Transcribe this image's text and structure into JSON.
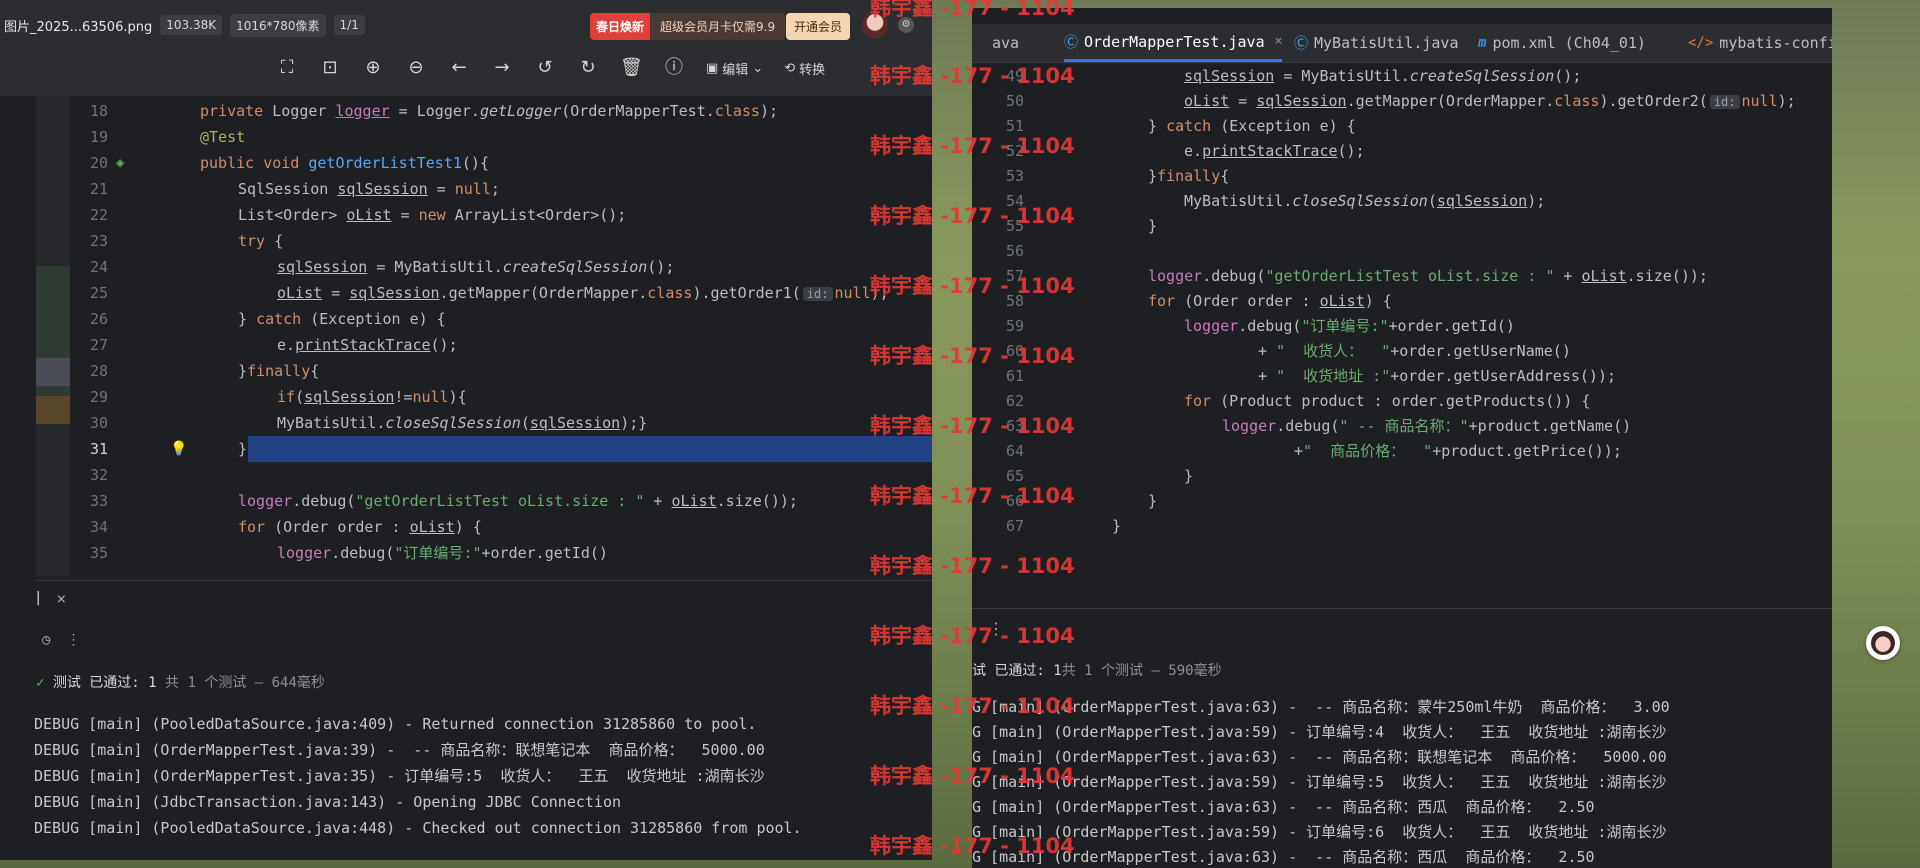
{
  "viewer": {
    "filename": "图片_2025...63506.png",
    "filesize": "103.38K",
    "dimensions": "1016*780像素",
    "page": "1/1",
    "promo_hot": "春日焕新",
    "promo_text": "超级会员月卡仅需9.9",
    "vip_button": "开通会员",
    "toolbar": {
      "edit_label": "编辑",
      "convert_label": "转换"
    }
  },
  "left_code": {
    "lines": [
      {
        "n": "18"
      },
      {
        "n": "19"
      },
      {
        "n": "20"
      },
      {
        "n": "21"
      },
      {
        "n": "22"
      },
      {
        "n": "23"
      },
      {
        "n": "24"
      },
      {
        "n": "25"
      },
      {
        "n": "26"
      },
      {
        "n": "27"
      },
      {
        "n": "28"
      },
      {
        "n": "29"
      },
      {
        "n": "30"
      },
      {
        "n": "31"
      },
      {
        "n": "32"
      },
      {
        "n": "33"
      },
      {
        "n": "34"
      },
      {
        "n": "35"
      }
    ],
    "text": {
      "l18a": "private ",
      "l18b": "Logger ",
      "l18c": "logger",
      "l18d": " = Logger.",
      "l18e": "getLogger",
      "l18f": "(OrderMapperTest.",
      "l18g": "class",
      "l18h": ");",
      "l19": "@Test",
      "l20a": "public void ",
      "l20b": "getOrderListTest1",
      "l20c": "(){",
      "l21a": "SqlSession ",
      "l21b": "sqlSession",
      "l21c": " = ",
      "l21d": "null",
      "l21e": ";",
      "l22a": "List<Order> ",
      "l22b": "oList",
      "l22c": " = ",
      "l22d": "new ",
      "l22e": "ArrayList<Order>();",
      "l23a": "try",
      "l23b": " {",
      "l24a": "sqlSession",
      "l24b": " = MyBatisUtil.",
      "l24c": "createSqlSession",
      "l24d": "();",
      "l25a": "oList",
      "l25b": " = ",
      "l25c": "sqlSession",
      "l25d": ".getMapper(OrderMapper.",
      "l25e": "class",
      "l25f": ").getOrder1(",
      "l25g": "id:",
      "l25h": "null",
      "l25i": ");",
      "l26a": "} ",
      "l26b": "catch",
      "l26c": " (Exception e) {",
      "l27a": "e.",
      "l27b": "printStackTrace",
      "l27c": "();",
      "l28a": "}",
      "l28b": "finally",
      "l28c": "{",
      "l29a": "if",
      "l29b": "(",
      "l29c": "sqlSession",
      "l29d": "!=",
      "l29e": "null",
      "l29f": "){",
      "l30a": "MyBatisUtil.",
      "l30b": "closeSqlSession",
      "l30c": "(",
      "l30d": "sqlSession",
      "l30e": ");}",
      "l31": "}",
      "l33a": "logger",
      "l33b": ".debug(",
      "l33c": "\"getOrderListTest oList.size : \"",
      "l33d": " + ",
      "l33e": "oList",
      "l33f": ".size());",
      "l34a": "for",
      "l34b": " (Order order : ",
      "l34c": "oList",
      "l34d": ") {",
      "l35a": "logger",
      "l35b": ".debug(",
      "l35c": "\"订单编号:\"",
      "l35d": "+order.getId()"
    }
  },
  "left_panel": {
    "close_symbol": "×",
    "status_passed": "测试 已通过: 1",
    "status_detail": "共 1 个测试 – 644毫秒",
    "logs": [
      "DEBUG [main] (PooledDataSource.java:409) - Returned connection 31285860 to pool.",
      "DEBUG [main] (OrderMapperTest.java:39) -  -- 商品名称：联想笔记本  商品价格：  5000.00",
      "DEBUG [main] (OrderMapperTest.java:35) - 订单编号:5  收货人：  王五  收货地址 :湖南长沙",
      "DEBUG [main] (JdbcTransaction.java:143) - Opening JDBC Connection",
      "DEBUG [main] (PooledDataSource.java:448) - Checked out connection 31285860 from pool."
    ]
  },
  "ide": {
    "tabs": [
      {
        "label": "ava"
      },
      {
        "label": "OrderMapperTest.java",
        "close": "×"
      },
      {
        "label": "MyBatisUtil.java"
      },
      {
        "label": "pom.xml (Ch04_01)"
      },
      {
        "label": "mybatis-config.x"
      }
    ],
    "lines": [
      {
        "n": "49"
      },
      {
        "n": "50"
      },
      {
        "n": "51"
      },
      {
        "n": "52"
      },
      {
        "n": "53"
      },
      {
        "n": "54"
      },
      {
        "n": "55"
      },
      {
        "n": "56"
      },
      {
        "n": "57"
      },
      {
        "n": "58"
      },
      {
        "n": "59"
      },
      {
        "n": "60"
      },
      {
        "n": "61"
      },
      {
        "n": "62"
      },
      {
        "n": "63"
      },
      {
        "n": "64"
      },
      {
        "n": "65"
      },
      {
        "n": "66"
      },
      {
        "n": "67"
      }
    ],
    "text": {
      "r49a": "sqlSession",
      "r49b": " = MyBatisUtil.",
      "r49c": "createSqlSession",
      "r49d": "();",
      "r50a": "oList",
      "r50b": " = ",
      "r50c": "sqlSession",
      "r50d": ".getMapper(OrderMapper.",
      "r50e": "class",
      "r50f": ").getOrder2(",
      "r50g": "id:",
      "r50h": "null",
      "r50i": ");",
      "r51a": "} ",
      "r51b": "catch",
      "r51c": " (Exception e) {",
      "r52a": "e.",
      "r52b": "printStackTrace",
      "r52c": "();",
      "r53a": "}",
      "r53b": "finally",
      "r53c": "{",
      "r54a": "MyBatisUtil.",
      "r54b": "closeSqlSession",
      "r54c": "(",
      "r54d": "sqlSession",
      "r54e": ");",
      "r55": "}",
      "r57a": "logger",
      "r57b": ".debug(",
      "r57c": "\"getOrderListTest oList.size : \"",
      "r57d": " + ",
      "r57e": "oList",
      "r57f": ".size());",
      "r58a": "for",
      "r58b": " (Order order : ",
      "r58c": "oList",
      "r58d": ") {",
      "r59a": "logger",
      "r59b": ".debug(",
      "r59c": "\"订单编号:\"",
      "r59d": "+order.getId()",
      "r60a": "+ ",
      "r60b": "\"  收货人：  \"",
      "r60c": "+order.getUserName()",
      "r61a": "+ ",
      "r61b": "\"  收货地址 :\"",
      "r61c": "+order.getUserAddress());",
      "r62a": "for",
      "r62b": " (Product product : order.getProducts()) {",
      "r63a": "logger",
      "r63b": ".debug(",
      "r63c": "\" -- 商品名称：\"",
      "r63d": "+product.getName()",
      "r64a": "+",
      "r64b": "\"  商品价格：  \"",
      "r64c": "+product.getPrice());",
      "r65": "}",
      "r66": "}",
      "r67": "}"
    }
  },
  "right_panel": {
    "status_prefix": "试",
    "status_passed": " 已通过: 1",
    "status_detail": "共 1 个测试 – 590毫秒",
    "logs": [
      "G [main] (OrderMapperTest.java:63) -  -- 商品名称：蒙牛250ml牛奶  商品价格：  3.00",
      "G [main] (OrderMapperTest.java:59) - 订单编号:4  收货人：  王五  收货地址 :湖南长沙",
      "G [main] (OrderMapperTest.java:63) -  -- 商品名称：联想笔记本  商品价格：  5000.00",
      "G [main] (OrderMapperTest.java:59) - 订单编号:5  收货人：  王五  收货地址 :湖南长沙",
      "G [main] (OrderMapperTest.java:63) -  -- 商品名称：西瓜  商品价格：  2.50",
      "G [main] (OrderMapperTest.java:59) - 订单编号:6  收货人：  王五  收货地址 :湖南长沙",
      "G [main] (OrderMapperTest.java:63) -  -- 商品名称：西瓜  商品价格：  2.50"
    ]
  },
  "watermark": {
    "text": "韩宇鑫 -177 - 1104",
    "items": [
      {
        "t": "韩宇鑫 -177 - 1104"
      },
      {
        "t": "韩宇鑫 -177 - 1104"
      },
      {
        "t": "韩宇鑫 -177 - 1104"
      },
      {
        "t": "韩宇鑫 -177 - 1104"
      },
      {
        "t": "韩宇鑫 -177 - 1104"
      },
      {
        "t": "韩宇鑫 -177 - 1104"
      },
      {
        "t": "韩宇鑫 -177 - 1104"
      },
      {
        "t": "韩宇鑫 -177 - 1104"
      },
      {
        "t": "韩宇鑫 -177 - 1104"
      },
      {
        "t": "韩宇鑫 -177 - 1104"
      },
      {
        "t": "韩宇鑫 -177 - 1104"
      },
      {
        "t": "韩宇鑫 -177 - 1104"
      },
      {
        "t": "韩宇鑫 -177 - 1104"
      }
    ]
  },
  "colors": {
    "keyword": "#cf8e6d",
    "string": "#6aab73",
    "field": "#c77dbb",
    "method": "#56a8f5",
    "selection": "#214283",
    "watermark": "#e53935"
  }
}
